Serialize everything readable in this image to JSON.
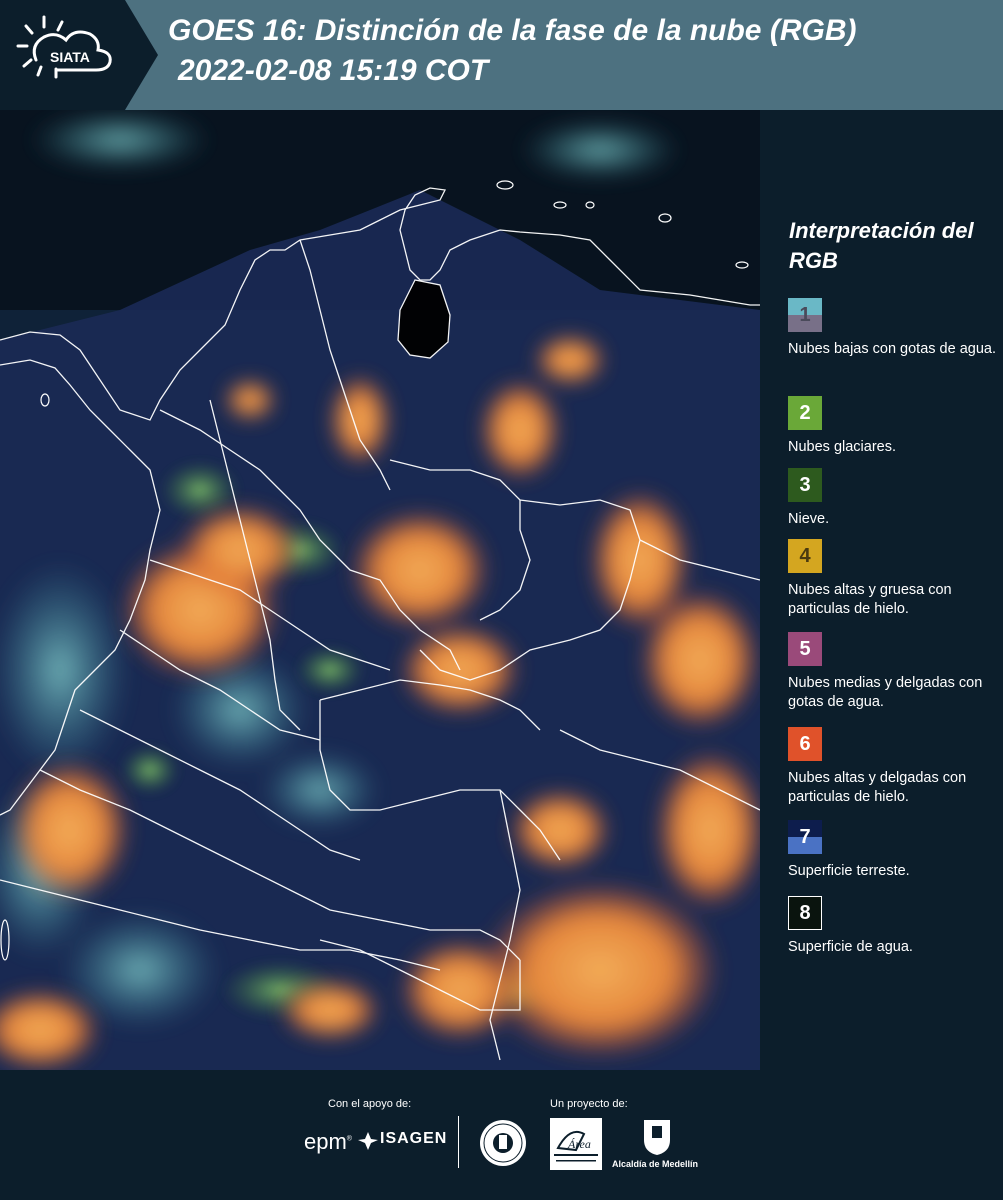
{
  "header": {
    "logo_text": "SIATA",
    "title_line1": "GOES 16: Distinción de la fase de la nube (RGB)",
    "title_line2": "2022-02-08 15:19 COT"
  },
  "legend": {
    "title": "Interpretación del RGB",
    "items": [
      {
        "number": "1",
        "label": "Nubes bajas con gotas de agua.",
        "color_top": "#6ab8c6",
        "color_bottom": "#787088"
      },
      {
        "number": "2",
        "label": "Nubes glaciares.",
        "color": "#6aa838"
      },
      {
        "number": "3",
        "label": "Nieve.",
        "color": "#2d5a1e"
      },
      {
        "number": "4",
        "label": "Nubes altas y gruesa con particulas de hielo.",
        "color": "#d4a620"
      },
      {
        "number": "5",
        "label": "Nubes medias y delgadas con gotas de agua.",
        "color": "#9a4a7a"
      },
      {
        "number": "6",
        "label": "Nubes altas y delgadas con particulas de hielo.",
        "color": "#e0522a"
      },
      {
        "number": "7",
        "label": "Superficie terreste.",
        "color_top": "#0d1d4d",
        "color_bottom": "#4a72c4"
      },
      {
        "number": "8",
        "label": "Superficie de agua.",
        "color": "#0a140e"
      }
    ]
  },
  "footer": {
    "support_label": "Con el apoyo de:",
    "project_label": "Un proyecto de:",
    "sponsors": [
      "epm",
      "ISAGEN"
    ],
    "partners": [
      "Área Metropolitana",
      "Alcaldía de Medellín"
    ],
    "partner_label": "Alcaldía de Medellín",
    "epm_text": "epm",
    "isagen_text": "ISAGEN"
  }
}
